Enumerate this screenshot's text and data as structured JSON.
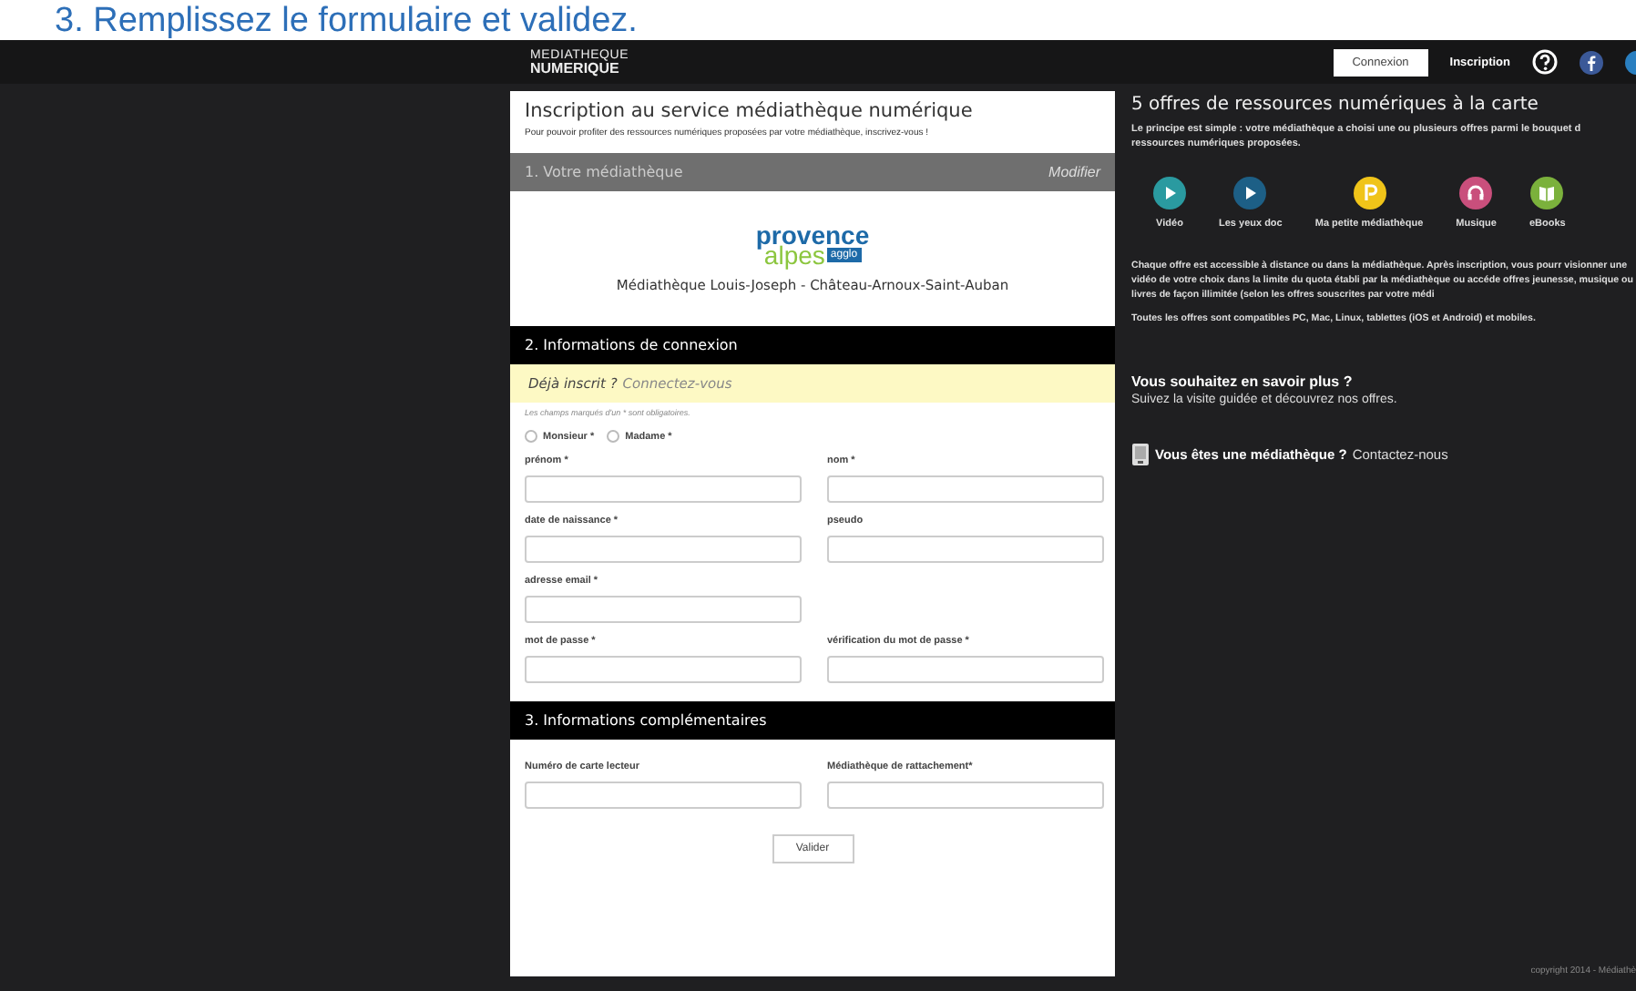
{
  "caption": "3. Remplissez le formulaire et validez.",
  "header": {
    "logo": [
      "MEDIATHEQUE",
      "NUMERIQUE"
    ],
    "connexion": "Connexion",
    "inscription": "Inscription"
  },
  "form": {
    "title": "Inscription au service médiathèque numérique",
    "subtitle": "Pour pouvoir profiter des ressources numériques proposées par votre médiathèque, inscrivez-vous !",
    "section1": {
      "title": "1. Votre médiathèque",
      "action": "Modifier"
    },
    "partner": {
      "logo_top": "provence",
      "logo_bottom": "alpes",
      "logo_badge": "agglo",
      "name": "Médiathèque Louis-Joseph - Château-Arnoux-Saint-Auban"
    },
    "section2": {
      "title": "2. Informations de connexion"
    },
    "login_hint": {
      "question": "Déjà inscrit ?",
      "link": "Connectez-vous"
    },
    "required_note": "Les champs marqués d'un * sont obligatoires.",
    "civility": [
      {
        "label": "Monsieur *",
        "selected": false
      },
      {
        "label": "Madame *",
        "selected": false
      }
    ],
    "rows": [
      [
        {
          "label": "prénom *"
        },
        {
          "label": "nom *"
        }
      ],
      [
        {
          "label": "date de naissance *"
        },
        {
          "label": "pseudo"
        }
      ],
      [
        {
          "label": "adresse email *"
        }
      ],
      [
        {
          "label": "mot de passe *"
        },
        {
          "label": "vérification du mot de passe *"
        }
      ]
    ],
    "section3": {
      "title": "3. Informations complémentaires"
    },
    "rows3": [
      [
        {
          "label": "Numéro de carte lecteur"
        },
        {
          "label": "Médiathèque de rattachement*"
        }
      ]
    ],
    "submit": "Valider"
  },
  "side": {
    "title": "5 offres de ressources numériques à la carte",
    "intro": "Le principe est simple : votre médiathèque a choisi une ou plusieurs offres parmi le bouquet d ressources numériques proposées.",
    "offers": [
      {
        "label": "Vidéo",
        "kind": "play",
        "color": "#2a9aa0"
      },
      {
        "label": "Les yeux doc",
        "kind": "play",
        "color": "#1d5f86"
      },
      {
        "label": "Ma petite médiathèque",
        "kind": "letter",
        "color": "#f0c419"
      },
      {
        "label": "Musique",
        "kind": "headphones",
        "color": "#c94f7c"
      },
      {
        "label": "eBooks",
        "kind": "book",
        "color": "#7bb13c"
      }
    ],
    "paragraph": "Chaque offre est accessible à distance ou dans la médiathèque. Après inscription, vous pourr visionner une vidéo de votre choix dans la limite du quota établi par la médiathèque ou accéde offres jeunesse, musique ou livres de façon illimitée (selon les offres souscrites par votre médi",
    "compat": "Toutes les offres sont compatibles PC, Mac, Linux, tablettes (iOS et Android) et mobiles.",
    "more_title": "Vous souhaitez en savoir plus ?",
    "more_link": "Suivez la visite guidée et découvrez nos offres.",
    "library_question": "Vous êtes une médiathèque ?",
    "library_link": "Contactez-nous",
    "copyright": "copyright 2014 - Médiathè"
  }
}
